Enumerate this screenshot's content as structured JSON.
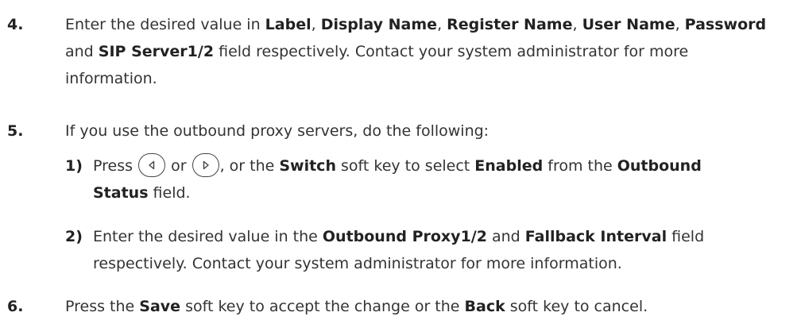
{
  "steps": [
    {
      "number": "4.",
      "lines": [
        [
          {
            "t": "Enter the desired value in "
          },
          {
            "t": "Label",
            "b": true
          },
          {
            "t": ", "
          },
          {
            "t": "Display Name",
            "b": true
          },
          {
            "t": ", "
          },
          {
            "t": "Register Name",
            "b": true
          },
          {
            "t": ", "
          },
          {
            "t": "User Name",
            "b": true
          },
          {
            "t": ", "
          },
          {
            "t": "Password",
            "b": true
          }
        ],
        [
          {
            "t": "and "
          },
          {
            "t": "SIP Server1/2",
            "b": true
          },
          {
            "t": " field respectively. Contact your system administrator for more"
          }
        ],
        [
          {
            "t": "information."
          }
        ]
      ]
    },
    {
      "number": "5.",
      "lines": [
        [
          {
            "t": "If you use the outbound proxy servers, do the following:"
          }
        ]
      ]
    },
    {
      "number": "1)",
      "lines": [
        [
          {
            "t": "Press "
          },
          {
            "icon": "left-key-icon"
          },
          {
            "t": " or "
          },
          {
            "icon": "right-key-icon"
          },
          {
            "t": ", or the "
          },
          {
            "t": "Switch",
            "b": true
          },
          {
            "t": " soft key to select "
          },
          {
            "t": "Enabled",
            "b": true
          },
          {
            "t": " from the "
          },
          {
            "t": "Outbound",
            "b": true
          }
        ],
        [
          {
            "t": "Status",
            "b": true
          },
          {
            "t": " field."
          }
        ]
      ]
    },
    {
      "number": "2)",
      "lines": [
        [
          {
            "t": "Enter the desired value in the "
          },
          {
            "t": "Outbound Proxy1/2",
            "b": true
          },
          {
            "t": " and "
          },
          {
            "t": "Fallback Interval",
            "b": true
          },
          {
            "t": " field"
          }
        ],
        [
          {
            "t": "respectively. Contact your system administrator for more information."
          }
        ]
      ]
    },
    {
      "number": "6.",
      "lines": [
        [
          {
            "t": "Press the "
          },
          {
            "t": "Save",
            "b": true
          },
          {
            "t": " soft key to accept the change or the "
          },
          {
            "t": "Back",
            "b": true
          },
          {
            "t": " soft key to cancel."
          }
        ]
      ]
    }
  ]
}
